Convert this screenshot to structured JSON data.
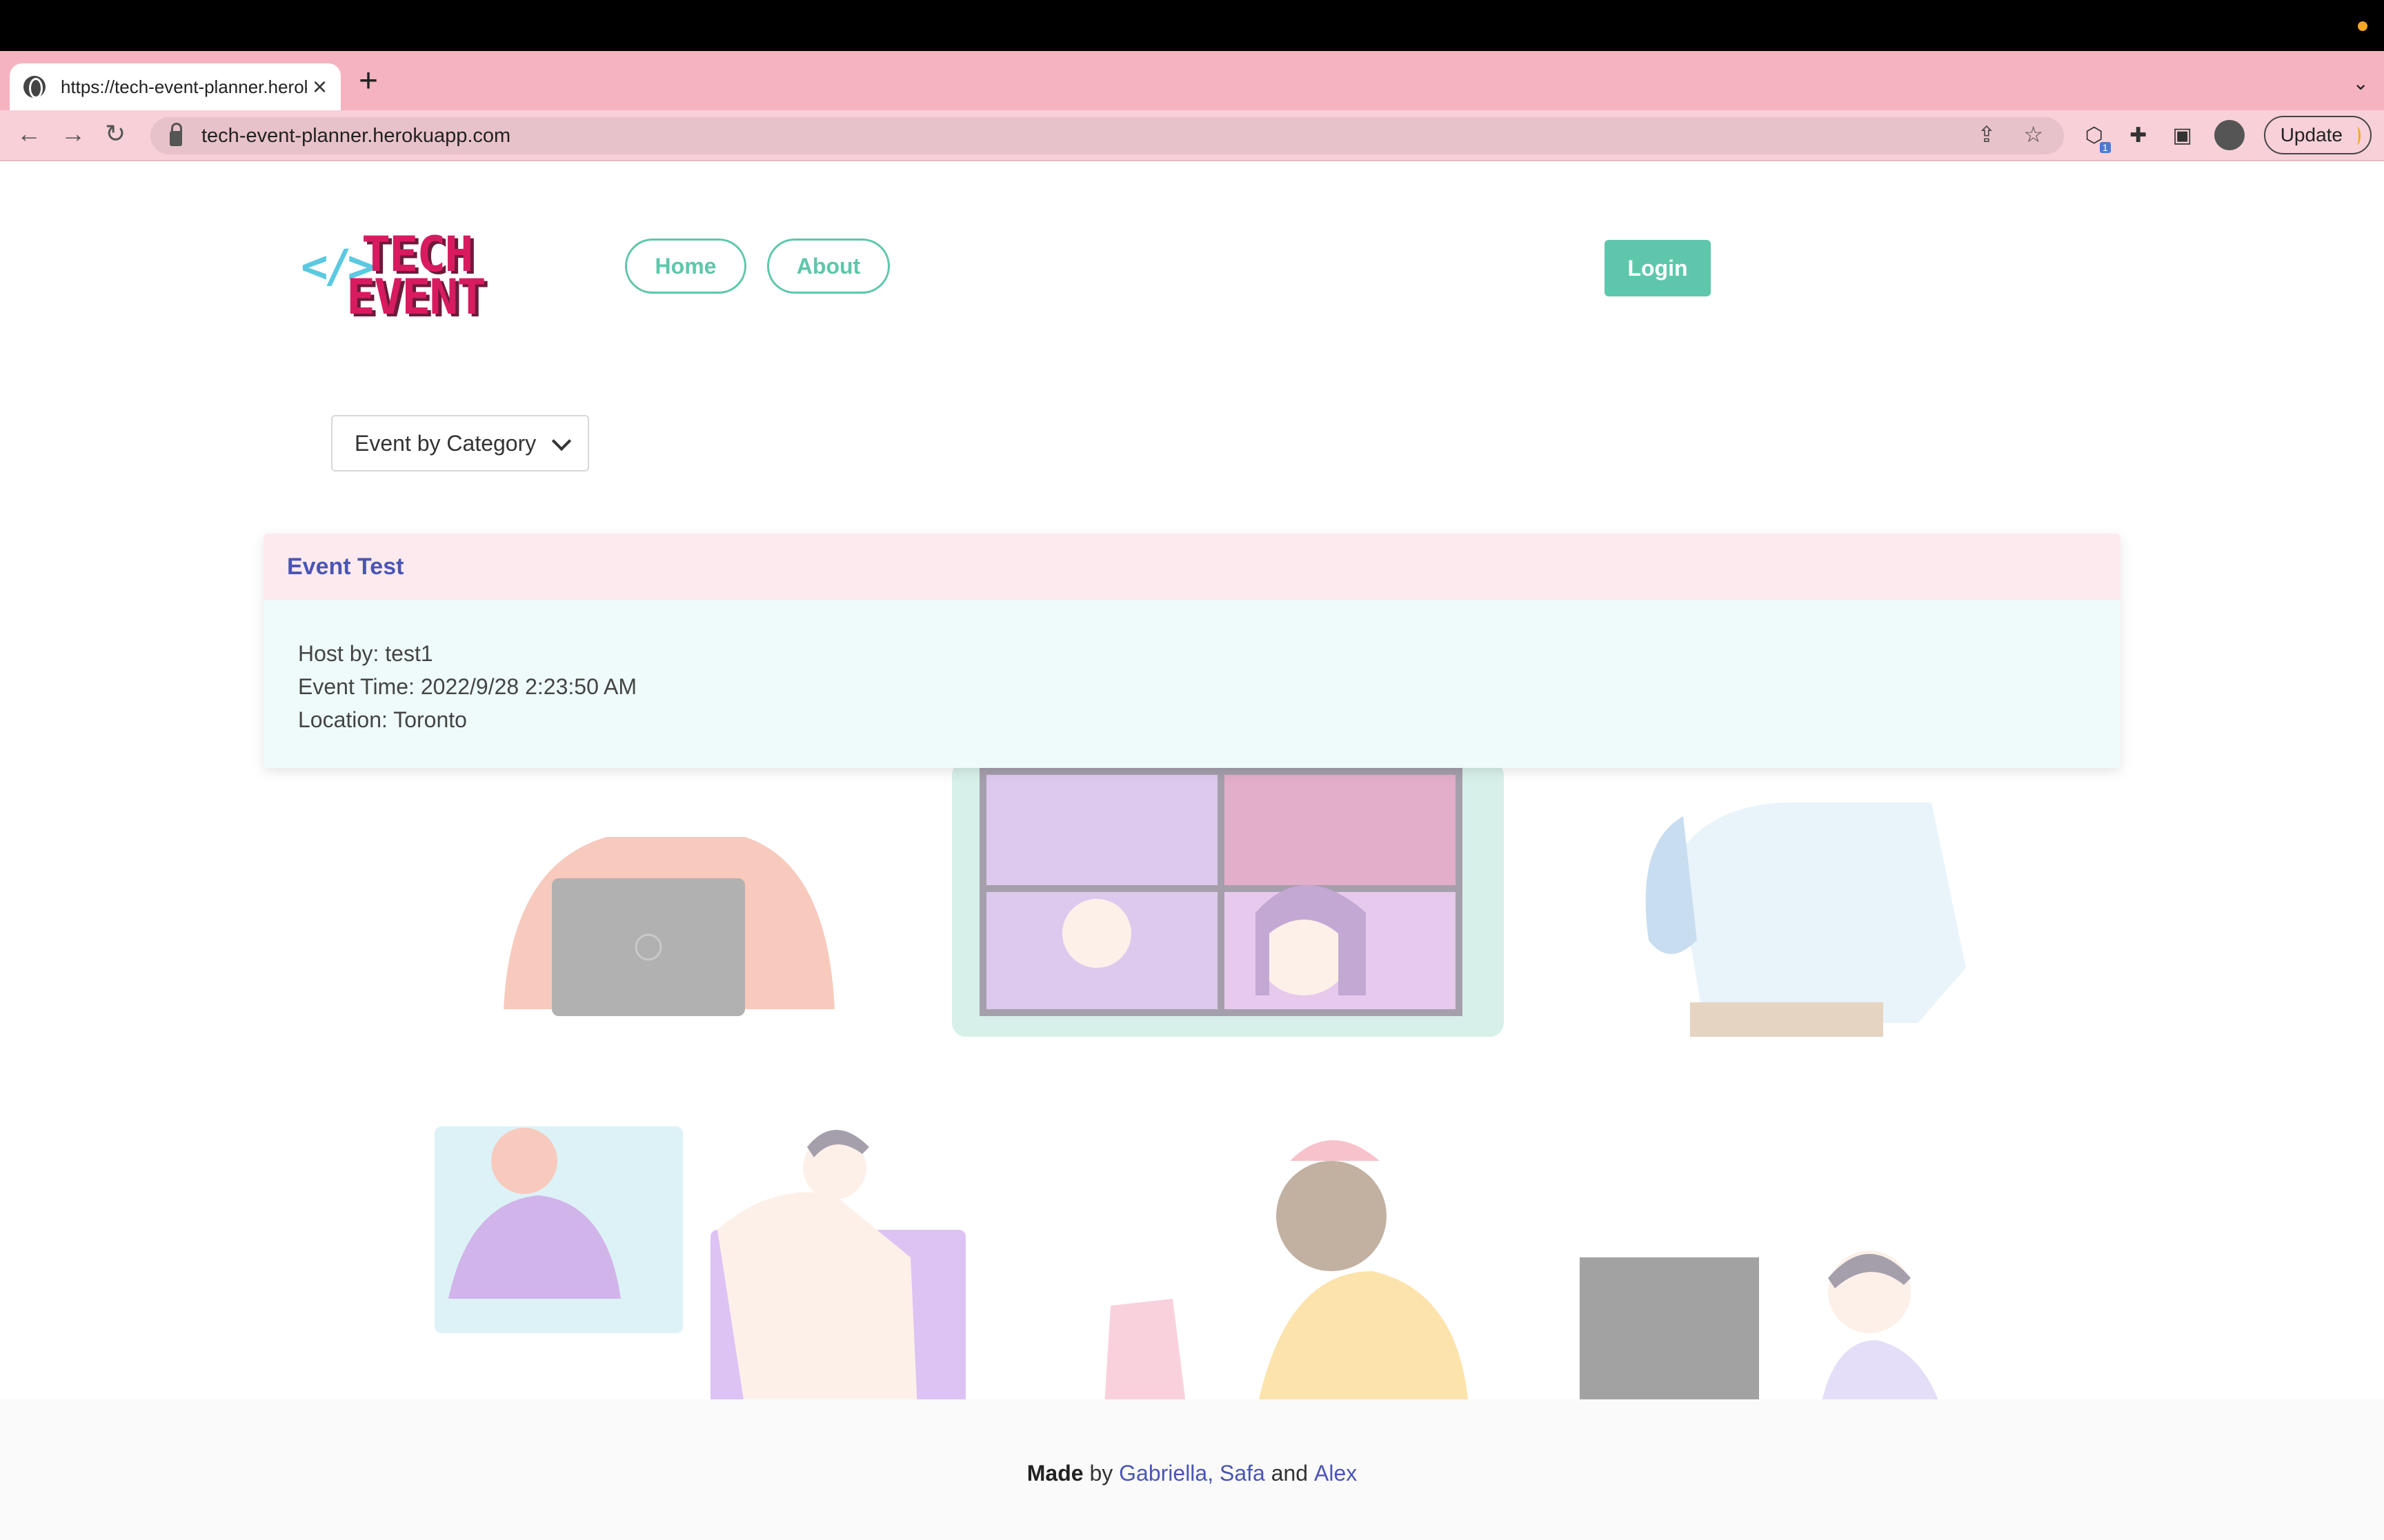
{
  "browser": {
    "tab_title": "https://tech-event-planner.herokuapp.com",
    "url": "tech-event-planner.herokuapp.com",
    "update_label": "Update",
    "extension_badge": "1"
  },
  "header": {
    "logo_line1": "TECH",
    "logo_line2": "EVENT",
    "logo_brackets": "</>",
    "nav": {
      "home": "Home",
      "about": "About"
    },
    "login_label": "Login"
  },
  "filter": {
    "selected": "Event by Category"
  },
  "event": {
    "title": "Event Test",
    "host": "Host by: test1",
    "time": "Event Time: 2022/9/28 2:23:50 AM",
    "location": "Location: Toronto"
  },
  "footer": {
    "made": "Made",
    "by": "by",
    "author1": "Gabriella,",
    "author2": "Safa",
    "and": "and",
    "author3": "Alex"
  },
  "colors": {
    "accent": "#5ec7ab",
    "event_title": "#4a55b5",
    "tab_strip": "#f5b3bf"
  }
}
